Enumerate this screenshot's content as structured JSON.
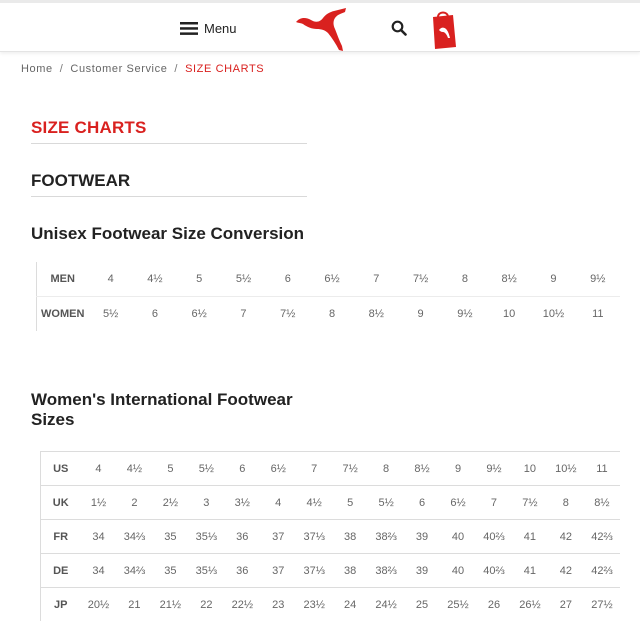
{
  "header": {
    "menu_label": "Menu",
    "brand_color": "#d9211f",
    "icons": [
      "hamburger-icon",
      "puma-logo",
      "search-icon",
      "cart-icon"
    ]
  },
  "breadcrumb": {
    "items": [
      "Home",
      "Customer Service",
      "SIZE CHARTS"
    ],
    "separator": "/"
  },
  "page": {
    "title": "SIZE CHARTS",
    "section": "FOOTWEAR"
  },
  "unisex": {
    "title": "Unisex Footwear Size Conversion",
    "rows": [
      {
        "label": "MEN",
        "values": [
          "4",
          "4½",
          "5",
          "5½",
          "6",
          "6½",
          "7",
          "7½",
          "8",
          "8½",
          "9",
          "9½"
        ]
      },
      {
        "label": "WOMEN",
        "values": [
          "5½",
          "6",
          "6½",
          "7",
          "7½",
          "8",
          "8½",
          "9",
          "9½",
          "10",
          "10½",
          "11"
        ]
      }
    ]
  },
  "womens": {
    "title": "Women's International Footwear Sizes",
    "rows": [
      {
        "label": "US",
        "values": [
          "4",
          "4½",
          "5",
          "5½",
          "6",
          "6½",
          "7",
          "7½",
          "8",
          "8½",
          "9",
          "9½",
          "10",
          "10½",
          "11"
        ]
      },
      {
        "label": "UK",
        "values": [
          "1½",
          "2",
          "2½",
          "3",
          "3½",
          "4",
          "4½",
          "5",
          "5½",
          "6",
          "6½",
          "7",
          "7½",
          "8",
          "8½"
        ]
      },
      {
        "label": "FR",
        "values": [
          "34",
          "34⅔",
          "35",
          "35⅓",
          "36",
          "37",
          "37⅓",
          "38",
          "38⅔",
          "39",
          "40",
          "40⅔",
          "41",
          "42",
          "42⅔"
        ]
      },
      {
        "label": "DE",
        "values": [
          "34",
          "34⅔",
          "35",
          "35⅓",
          "36",
          "37",
          "37⅓",
          "38",
          "38⅔",
          "39",
          "40",
          "40⅔",
          "41",
          "42",
          "42⅔"
        ]
      },
      {
        "label": "JP",
        "values": [
          "20½",
          "21",
          "21½",
          "22",
          "22½",
          "23",
          "23½",
          "24",
          "24½",
          "25",
          "25½",
          "26",
          "26½",
          "27",
          "27½"
        ]
      }
    ]
  }
}
